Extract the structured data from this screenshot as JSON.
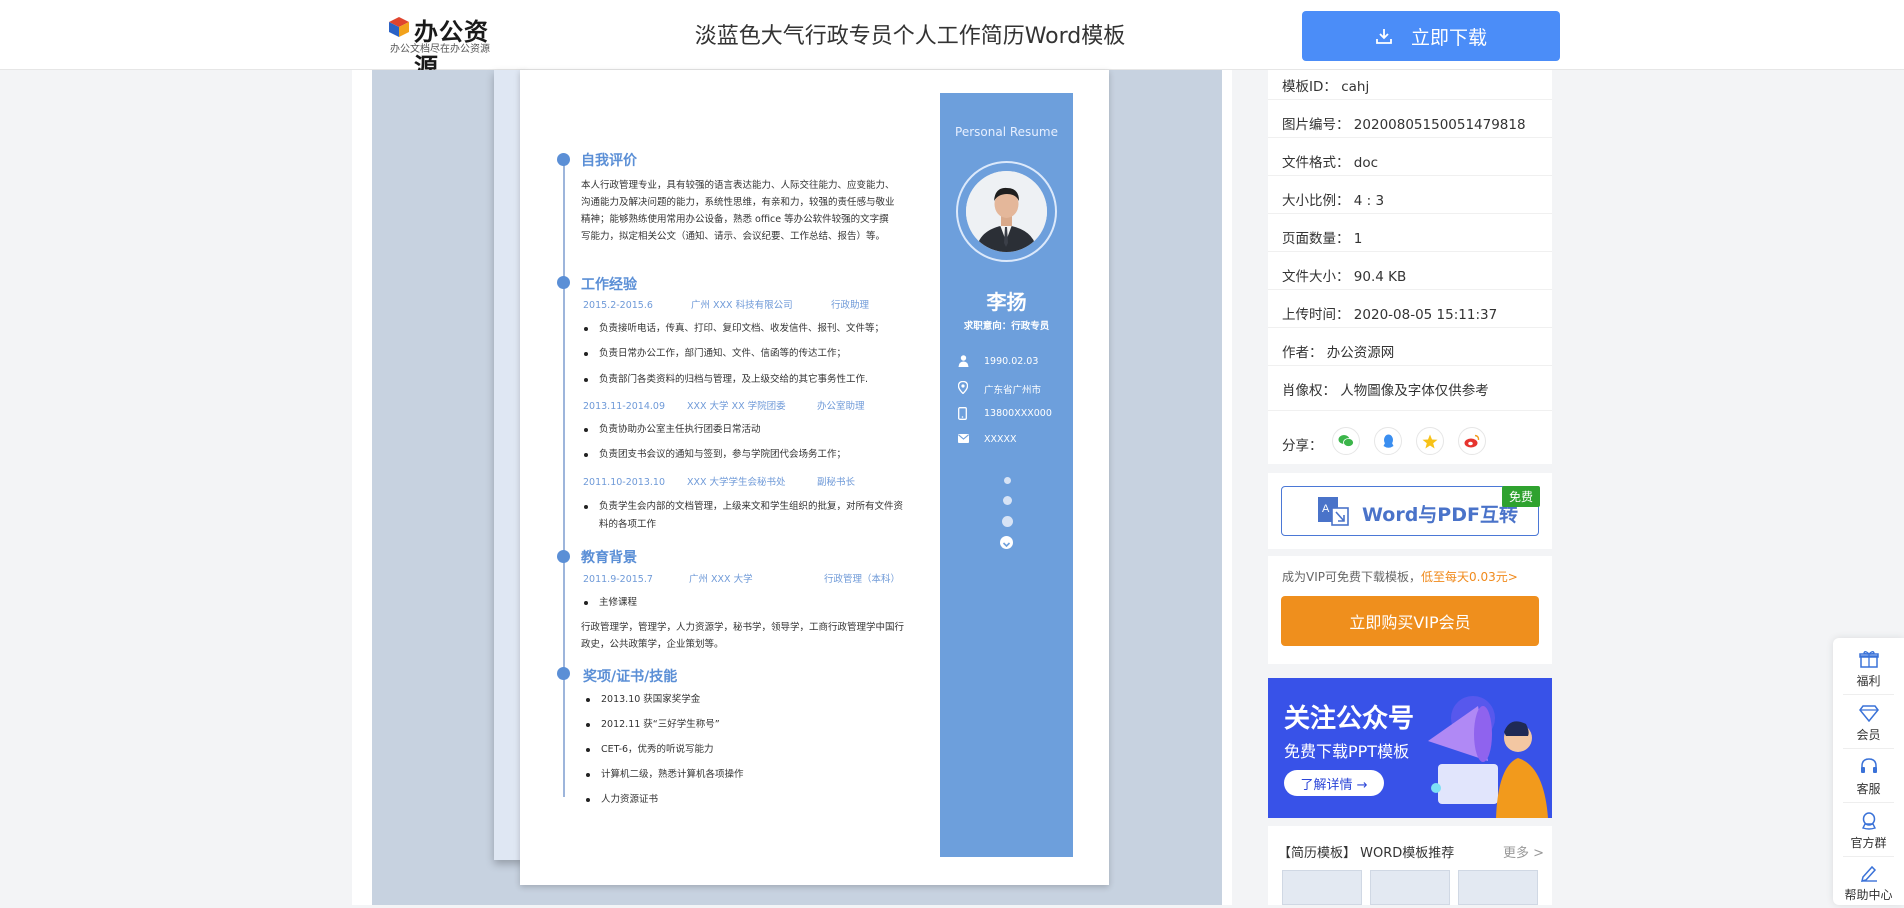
{
  "header": {
    "logo_text": "办公资源",
    "logo_sub": "办公文档尽在办公资源",
    "title": "淡蓝色大气行政专员个人工作简历Word模板",
    "download_label": "立即下载"
  },
  "resume": {
    "side_title": "Personal Resume",
    "name": "李扬",
    "intent": "求职意向：行政专员",
    "birth": "1990.02.03",
    "location": "广东省广州市",
    "phone": "13800XXX000",
    "email": "XXXXX",
    "sections": {
      "self_eval_title": "自我评价",
      "self_eval_text": "本人行政管理专业，具有较强的语言表达能力、人际交往能力、应变能力、沟通能力及解决问题的能力，系统性思维，有亲和力，较强的责任感与敬业精神；能够熟练使用常用办公设备，熟悉 office 等办公软件较强的文字撰写能力，拟定相关公文（通知、请示、会议纪要、工作总结、报告）等。",
      "work_title": "工作经验",
      "edu_title": "教育背景",
      "award_title": "奖项/证书/技能"
    },
    "jobs": [
      {
        "date": "2015.2-2015.6",
        "org": "广州 XXX 科技有限公司",
        "role": "行政助理",
        "bullets": [
          "负责接听电话，传真、打印、复印文档、收发信件、报刊、文件等；",
          "负责日常办公工作，部门通知、文件、信函等的传达工作；",
          "负责部门各类资料的归档与管理，及上级交给的其它事务性工作."
        ]
      },
      {
        "date": "2013.11-2014.09",
        "org": "XXX 大学 XX 学院团委",
        "role": "办公室助理",
        "bullets": [
          "负责协助办公室主任执行团委日常活动",
          "负责团支书会议的通知与签到，参与学院团代会场务工作；"
        ]
      },
      {
        "date": "2011.10-2013.10",
        "org": "XXX 大学学生会秘书处",
        "role": "副秘书长",
        "bullets": [
          "负责学生会内部的文档管理，上级来文和学生组织的批复，对所有文件资料的各项工作"
        ]
      }
    ],
    "education": {
      "date": "2011.9-2015.7",
      "school": "广州 XXX 大学",
      "major": "行政管理（本科）",
      "bullet": "主修课程",
      "courses": "行政管理学，管理学，人力资源学，秘书学，领导学，工商行政管理学中国行政史，公共政策学，企业策划等。"
    },
    "awards": [
      "2013.10 获国家奖学金",
      "2012.11 获“三好学生称号”",
      "CET-6，优秀的听说写能力",
      "计算机二级，熟悉计算机各项操作",
      "人力资源证书"
    ]
  },
  "info": {
    "rows": [
      {
        "k": "模板ID：",
        "v": "cahj"
      },
      {
        "k": "图片编号：",
        "v": "20200805150051479818"
      },
      {
        "k": "文件格式：",
        "v": "doc"
      },
      {
        "k": "大小比例：",
        "v": "4 : 3"
      },
      {
        "k": "页面数量：",
        "v": "1"
      },
      {
        "k": "文件大小：",
        "v": "90.4 KB"
      },
      {
        "k": "上传时间：",
        "v": "2020-08-05 15:11:37"
      },
      {
        "k": "作者：",
        "v": "办公资源网"
      },
      {
        "k": "肖像权：",
        "v": "人物圖像及字体仅供参考"
      }
    ],
    "share_label": "分享："
  },
  "pdf": {
    "label": "Word与PDF互转",
    "badge": "免费"
  },
  "vip": {
    "note": "成为VIP可免费下载模板，",
    "note_orange": "低至每天0.03元>",
    "button": "立即购买VIP会员"
  },
  "banner": {
    "h1": "关注公众号",
    "h2": "免费下载PPT模板",
    "more": "了解详情 →"
  },
  "recommend": {
    "title": "【简历模板】 WORD模板推荐",
    "more": "更多 >"
  },
  "float": [
    "福利",
    "会员",
    "客服",
    "官方群",
    "帮助中心"
  ],
  "colors": {
    "accent": "#4b8df8",
    "resume_blue": "#6d9fdc",
    "vip_orange": "#ef8f1d",
    "free_green": "#2fa22f",
    "banner_blue": "#3852e8"
  }
}
